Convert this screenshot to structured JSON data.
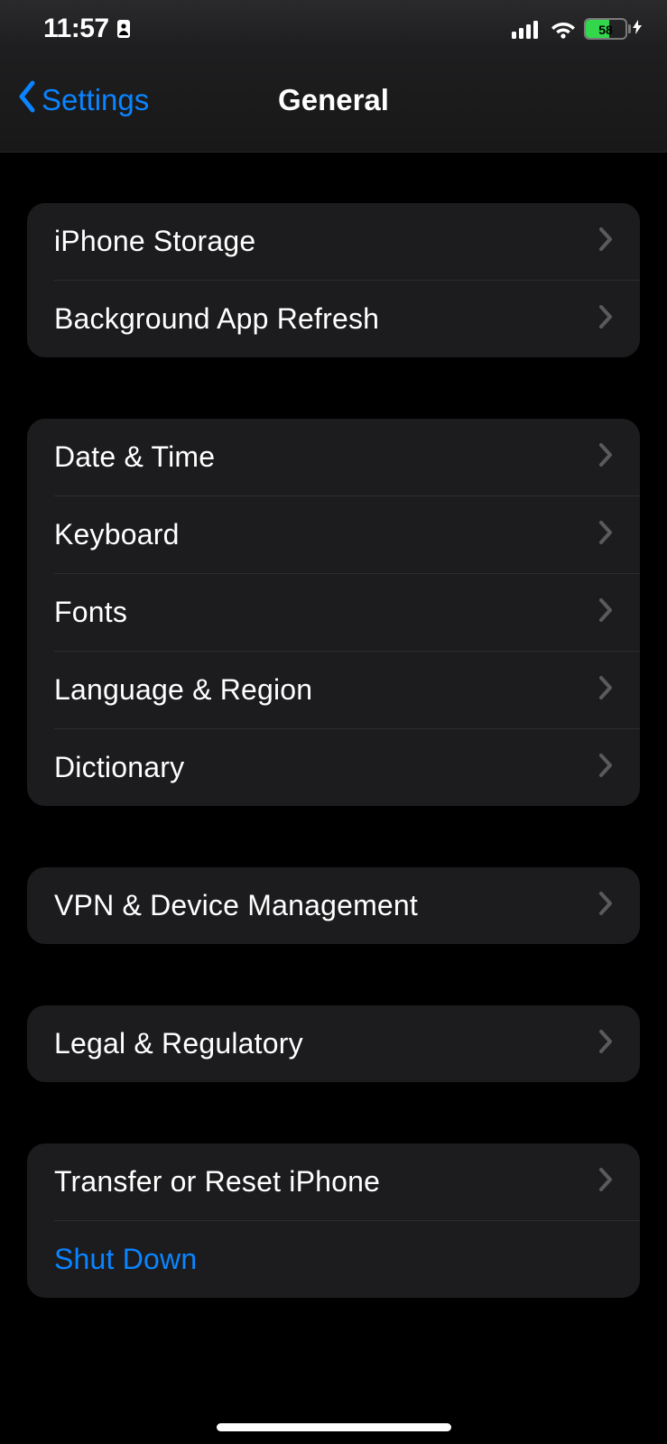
{
  "statusBar": {
    "time": "11:57",
    "batteryPercent": "58"
  },
  "nav": {
    "backLabel": "Settings",
    "title": "General"
  },
  "groups": [
    {
      "rows": [
        {
          "label": "iPhone Storage",
          "name": "iphone-storage-row",
          "chevron": true
        },
        {
          "label": "Background App Refresh",
          "name": "background-app-refresh-row",
          "chevron": true
        }
      ]
    },
    {
      "rows": [
        {
          "label": "Date & Time",
          "name": "date-time-row",
          "chevron": true
        },
        {
          "label": "Keyboard",
          "name": "keyboard-row",
          "chevron": true
        },
        {
          "label": "Fonts",
          "name": "fonts-row",
          "chevron": true
        },
        {
          "label": "Language & Region",
          "name": "language-region-row",
          "chevron": true
        },
        {
          "label": "Dictionary",
          "name": "dictionary-row",
          "chevron": true
        }
      ]
    },
    {
      "rows": [
        {
          "label": "VPN & Device Management",
          "name": "vpn-device-management-row",
          "chevron": true
        }
      ]
    },
    {
      "rows": [
        {
          "label": "Legal & Regulatory",
          "name": "legal-regulatory-row",
          "chevron": true
        }
      ]
    },
    {
      "rows": [
        {
          "label": "Transfer or Reset iPhone",
          "name": "transfer-reset-row",
          "chevron": true
        },
        {
          "label": "Shut Down",
          "name": "shut-down-row",
          "chevron": false,
          "accent": true
        }
      ]
    }
  ]
}
